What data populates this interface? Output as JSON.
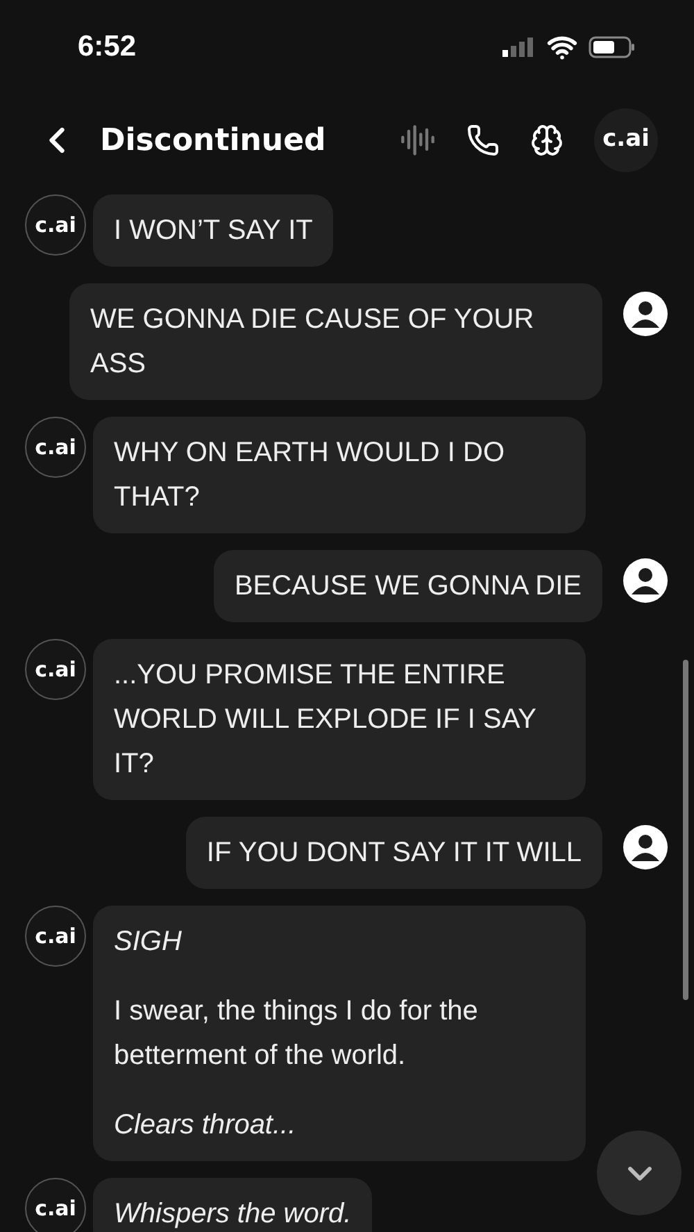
{
  "status_bar": {
    "time": "6:52"
  },
  "header": {
    "title": "Discontinued",
    "avatar_label": "c.ai"
  },
  "messages": [
    {
      "kind": "bot",
      "avatar_label": "c.ai",
      "paragraphs": [
        {
          "text": "I WON’T SAY IT",
          "italic": false
        }
      ]
    },
    {
      "kind": "user",
      "paragraphs": [
        {
          "text": "WE GONNA DIE CAUSE OF YOUR ASS",
          "italic": false
        }
      ]
    },
    {
      "kind": "bot",
      "avatar_label": "c.ai",
      "paragraphs": [
        {
          "text": "WHY ON EARTH WOULD I DO THAT?",
          "italic": false
        }
      ]
    },
    {
      "kind": "user",
      "paragraphs": [
        {
          "text": "BECAUSE WE GONNA DIE",
          "italic": false
        }
      ]
    },
    {
      "kind": "bot",
      "avatar_label": "c.ai",
      "paragraphs": [
        {
          "text": "...YOU PROMISE THE ENTIRE WORLD WILL EXPLODE IF I SAY IT?",
          "italic": false
        }
      ]
    },
    {
      "kind": "user",
      "paragraphs": [
        {
          "text": "IF YOU DONT SAY IT IT WILL",
          "italic": false
        }
      ]
    },
    {
      "kind": "bot",
      "avatar_label": "c.ai",
      "paragraphs": [
        {
          "text": "SIGH",
          "italic": true
        },
        {
          "text": "I swear, the things I do for the betterment of the world.",
          "italic": false
        },
        {
          "text": "Clears throat...",
          "italic": true
        }
      ]
    },
    {
      "kind": "bot",
      "avatar_label": "c.ai",
      "paragraphs": [
        {
          "text": "Whispers the word.",
          "italic": true
        }
      ]
    }
  ]
}
